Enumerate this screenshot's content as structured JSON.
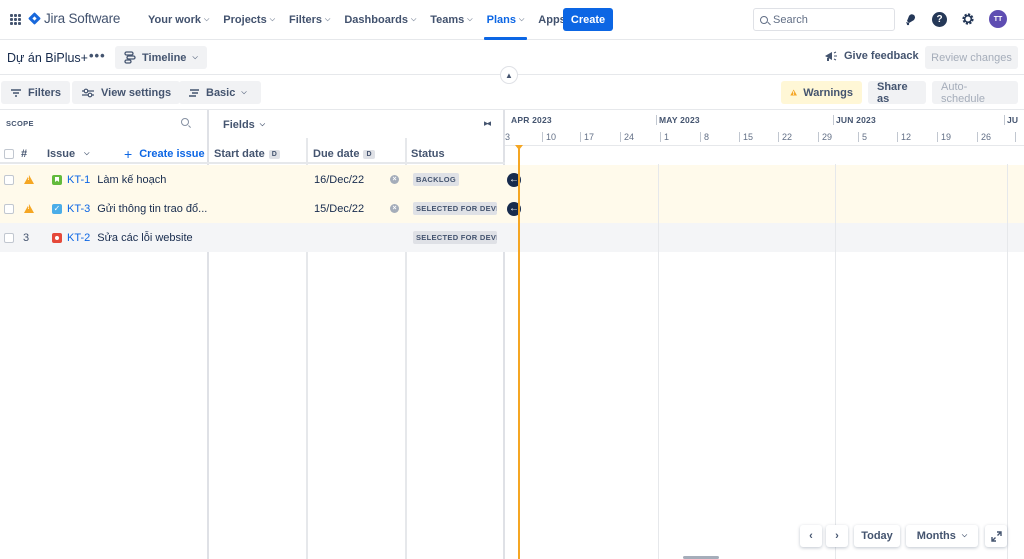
{
  "topnav": {
    "app_name": "Jira Software",
    "items": [
      {
        "label": "Your work",
        "active": false
      },
      {
        "label": "Projects",
        "active": false
      },
      {
        "label": "Filters",
        "active": false
      },
      {
        "label": "Dashboards",
        "active": false
      },
      {
        "label": "Teams",
        "active": false
      },
      {
        "label": "Plans",
        "active": true
      },
      {
        "label": "Apps",
        "active": false
      }
    ],
    "create_label": "Create",
    "search_placeholder": "Search",
    "avatar_initials": "TT",
    "icons": [
      "app-switcher-icon",
      "notifications-icon",
      "help-icon",
      "settings-icon"
    ]
  },
  "project_bar": {
    "project_name": "Dự án BiPlus+",
    "more_label": "•••",
    "view_label": "Timeline",
    "feedback_label": "Give feedback",
    "review_label": "Review changes"
  },
  "toolbar": {
    "filters_label": "Filters",
    "view_settings_label": "View settings",
    "basic_label": "Basic",
    "warnings_label": "Warnings",
    "share_label": "Share as",
    "auto_schedule_label": "Auto-schedule"
  },
  "scope": {
    "label": "SCOPE",
    "fields_label": "Fields",
    "columns": {
      "hash": "#",
      "issue": "Issue",
      "create_issue": "Create issue",
      "start_date": "Start date",
      "due_date": "Due date",
      "date_badge": "D",
      "status": "Status"
    }
  },
  "rows": [
    {
      "marker": "warning",
      "type": "story",
      "key": "KT-1",
      "summary": "Làm kế hoạch",
      "start_date": "",
      "due_date": "16/Dec/22",
      "status": "BACKLOG",
      "highlight": "warn"
    },
    {
      "marker": "warning",
      "type": "task",
      "key": "KT-3",
      "summary": "Gửi thông tin trao đổ...",
      "start_date": "",
      "due_date": "15/Dec/22",
      "status": "SELECTED FOR DEVELOPMENT",
      "highlight": "warn"
    },
    {
      "marker": "3",
      "type": "bug",
      "key": "KT-2",
      "summary": "Sửa các lỗi website",
      "start_date": "",
      "due_date": "",
      "status": "SELECTED FOR DEVELOPMENT",
      "highlight": "alt"
    }
  ],
  "timeline": {
    "months": [
      "APR 2023",
      "MAY 2023",
      "JUN 2023",
      "JU"
    ],
    "weeks": [
      "3",
      "10",
      "17",
      "24",
      "1",
      "8",
      "15",
      "22",
      "29",
      "5",
      "12",
      "19",
      "26"
    ]
  },
  "bottom_controls": {
    "prev_label": "‹",
    "next_label": "›",
    "today_label": "Today",
    "scale_label": "Months"
  },
  "colors": {
    "accent": "#0c66e4",
    "today_line": "#f5a623",
    "warning_bg": "#fff7d6",
    "avatar": "#5e4db2"
  }
}
